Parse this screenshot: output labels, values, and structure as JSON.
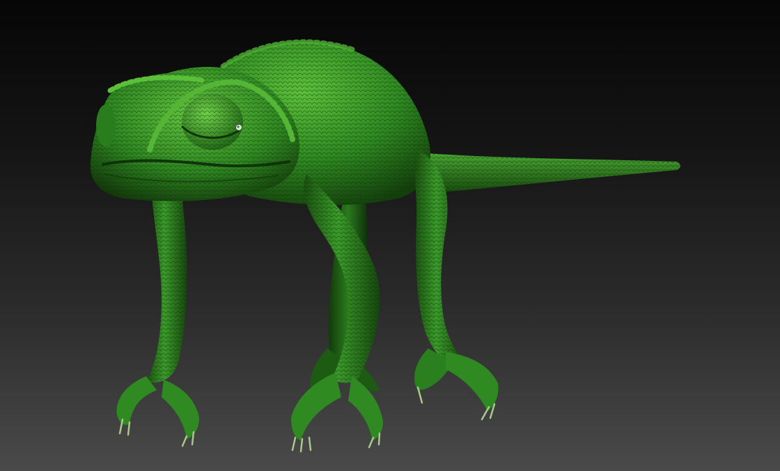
{
  "viewport": {
    "background_top": "#060606",
    "background_bottom": "#4a4a4a"
  },
  "model": {
    "subject": "chameleon",
    "skin_color": "#2f8a22",
    "skin_shadow": "#14400c",
    "skin_highlight": "#6fcf4a",
    "claw_color": "#a8c98a"
  }
}
